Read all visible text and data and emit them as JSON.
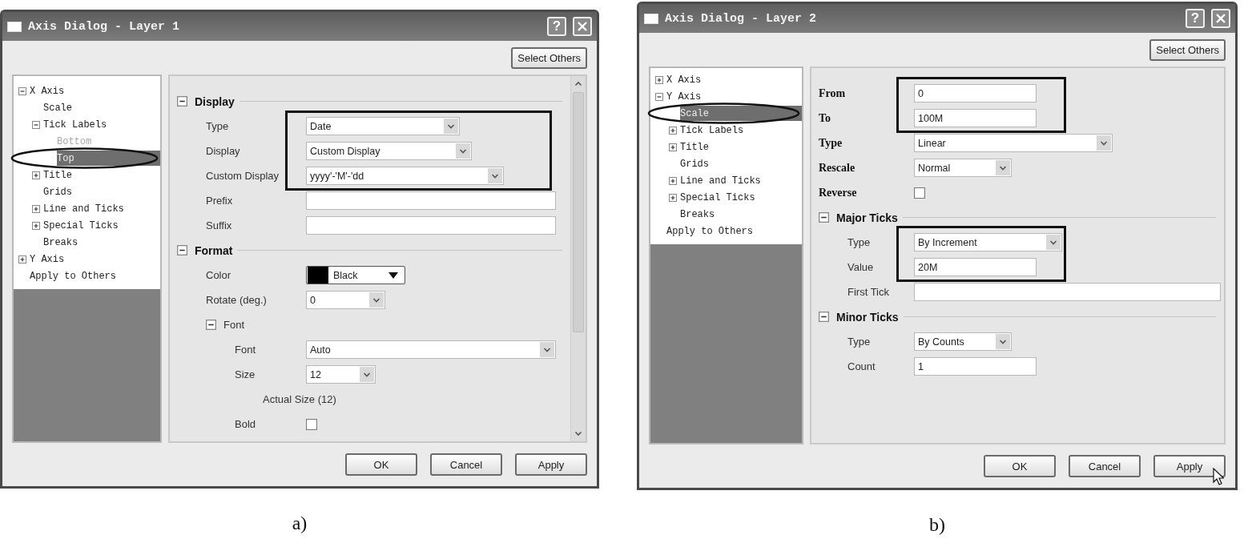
{
  "figures": [
    {
      "caption": "a)",
      "dialog": {
        "title": "Axis Dialog - Layer 1",
        "help": "?",
        "select_others": "Select Others",
        "scrollbar": true,
        "tree": [
          {
            "label": "X Axis",
            "expanded": true,
            "selected": false,
            "disabled": false,
            "children": [
              {
                "label": "Scale",
                "selected": false,
                "disabled": false
              },
              {
                "label": "Tick Labels",
                "expanded": true,
                "selected": false,
                "disabled": false,
                "children": [
                  {
                    "label": "Bottom",
                    "selected": false,
                    "disabled": true
                  },
                  {
                    "label": "Top",
                    "selected": true,
                    "disabled": false
                  }
                ]
              },
              {
                "label": "Title",
                "expanded": false,
                "selected": false,
                "disabled": false
              },
              {
                "label": "Grids",
                "selected": false,
                "disabled": false
              },
              {
                "label": "Line and Ticks",
                "expanded": false,
                "selected": false,
                "disabled": false
              },
              {
                "label": "Special Ticks",
                "expanded": false,
                "selected": false,
                "disabled": false
              },
              {
                "label": "Breaks",
                "selected": false,
                "disabled": false
              }
            ]
          },
          {
            "label": "Y Axis",
            "expanded": false,
            "selected": false,
            "disabled": false
          },
          {
            "label": "Apply to Others",
            "selected": false,
            "disabled": false
          }
        ],
        "properties": [
          {
            "kind": "section",
            "label": "Display",
            "expanded": true,
            "children": [
              {
                "kind": "combo",
                "label": "Type",
                "value": "Date",
                "highlighted": true
              },
              {
                "kind": "combo",
                "label": "Display",
                "value": "Custom Display",
                "highlighted": true
              },
              {
                "kind": "combo",
                "label": "Custom Display",
                "value": "yyyy'-'M'-'dd",
                "highlighted": true
              },
              {
                "kind": "text",
                "label": "Prefix",
                "highlighted": false
              },
              {
                "kind": "text",
                "label": "Suffix",
                "highlighted": false
              }
            ]
          },
          {
            "kind": "section",
            "label": "Format",
            "expanded": true,
            "children": [
              {
                "kind": "color",
                "label": "Color",
                "value": "Black",
                "color": "#000000",
                "highlighted": false
              },
              {
                "kind": "combo",
                "label": "Rotate (deg.)",
                "value": "0",
                "highlighted": false
              },
              {
                "kind": "section",
                "label": "Font",
                "expanded": true,
                "children": [
                  {
                    "kind": "combo",
                    "label": "Font",
                    "value": "Auto",
                    "highlighted": false
                  },
                  {
                    "kind": "combo",
                    "label": "Size",
                    "value": "12",
                    "highlighted": false
                  },
                  {
                    "kind": "note",
                    "label": "Actual Size (12)",
                    "highlighted": false
                  },
                  {
                    "kind": "check",
                    "label": "Bold",
                    "checked": false,
                    "highlighted": false
                  }
                ]
              }
            ]
          }
        ],
        "buttons": [
          {
            "label": "OK",
            "pointer": false
          },
          {
            "label": "Cancel",
            "pointer": false
          },
          {
            "label": "Apply",
            "pointer": false
          }
        ]
      }
    },
    {
      "caption": "b)",
      "dialog": {
        "title": "Axis Dialog - Layer 2",
        "help": "?",
        "select_others": "Select Others",
        "scrollbar": false,
        "tree": [
          {
            "label": "X Axis",
            "expanded": false,
            "selected": false,
            "disabled": false
          },
          {
            "label": "Y Axis",
            "expanded": true,
            "selected": false,
            "disabled": false,
            "children": [
              {
                "label": "Scale",
                "selected": true,
                "disabled": false
              },
              {
                "label": "Tick Labels",
                "expanded": false,
                "selected": false,
                "disabled": false
              },
              {
                "label": "Title",
                "expanded": false,
                "selected": false,
                "disabled": false
              },
              {
                "label": "Grids",
                "selected": false,
                "disabled": false
              },
              {
                "label": "Line and Ticks",
                "expanded": false,
                "selected": false,
                "disabled": false
              },
              {
                "label": "Special Ticks",
                "expanded": false,
                "selected": false,
                "disabled": false
              },
              {
                "label": "Breaks",
                "selected": false,
                "disabled": false
              }
            ]
          },
          {
            "label": "Apply to Others",
            "selected": false,
            "disabled": false
          }
        ],
        "properties": [
          {
            "kind": "text",
            "label": "From",
            "value": "0",
            "highlighted": true
          },
          {
            "kind": "text",
            "label": "To",
            "value": "100M",
            "highlighted": true
          },
          {
            "kind": "combo",
            "label": "Type",
            "value": "Linear",
            "highlighted": false
          },
          {
            "kind": "combo",
            "label": "Rescale",
            "value": "Normal",
            "highlighted": false
          },
          {
            "kind": "check",
            "label": "Reverse",
            "checked": false,
            "highlighted": false
          },
          {
            "kind": "section",
            "label": "Major Ticks",
            "expanded": true,
            "children": [
              {
                "kind": "combo",
                "label": "Type",
                "value": "By Increment",
                "highlighted": true
              },
              {
                "kind": "text",
                "label": "Value",
                "value": "20M",
                "highlighted": true
              },
              {
                "kind": "text",
                "label": "First Tick",
                "highlighted": false
              }
            ]
          },
          {
            "kind": "section",
            "label": "Minor Ticks",
            "expanded": true,
            "children": [
              {
                "kind": "combo",
                "label": "Type",
                "value": "By Counts",
                "highlighted": false
              },
              {
                "kind": "text",
                "label": "Count",
                "value": "1",
                "highlighted": false
              }
            ]
          }
        ],
        "buttons": [
          {
            "label": "OK",
            "pointer": false
          },
          {
            "label": "Cancel",
            "pointer": false
          },
          {
            "label": "Apply",
            "pointer": true
          }
        ]
      }
    }
  ]
}
